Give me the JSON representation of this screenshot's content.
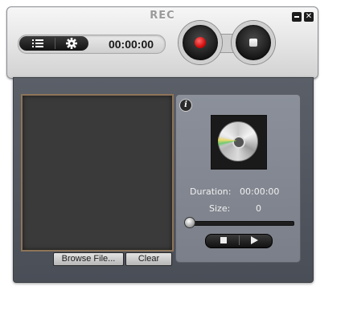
{
  "window": {
    "title": "REC",
    "minimize_icon": "minimize-icon",
    "close_icon": "close-icon",
    "close_glyph": "✕"
  },
  "toolbar": {
    "list_icon": "list-icon",
    "settings_icon": "gear-icon",
    "timer": "00:00:00",
    "record_icon": "record-icon",
    "stop_icon": "stop-icon",
    "record_color": "#d40d0d"
  },
  "preview": {
    "browse_label": "Browse File...",
    "clear_label": "Clear",
    "frame_color": "#8d7458"
  },
  "info_panel": {
    "info_glyph": "i",
    "thumbnail_icon": "cd-disc-icon",
    "duration_label": "Duration:",
    "duration_value": "00:00:00",
    "size_label": "Size:",
    "size_value": "0",
    "progress": 0,
    "stop_icon": "stop-icon",
    "play_icon": "play-icon"
  }
}
